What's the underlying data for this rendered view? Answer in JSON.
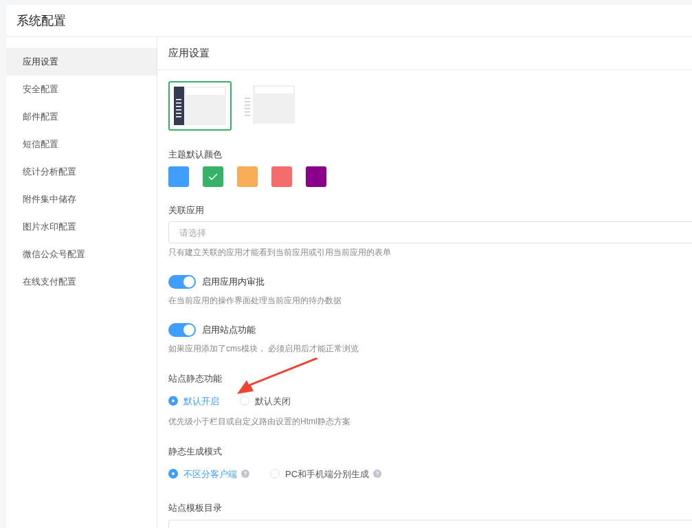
{
  "page_title": "系统配置",
  "sidebar": {
    "items": [
      {
        "label": "应用设置",
        "selected": true
      },
      {
        "label": "安全配置",
        "selected": false
      },
      {
        "label": "邮件配置",
        "selected": false
      },
      {
        "label": "短信配置",
        "selected": false
      },
      {
        "label": "统计分析配置",
        "selected": false
      },
      {
        "label": "附件集中储存",
        "selected": false
      },
      {
        "label": "图片水印配置",
        "selected": false
      },
      {
        "label": "微信公众号配置",
        "selected": false
      },
      {
        "label": "在线支付配置",
        "selected": false
      }
    ]
  },
  "content": {
    "title": "应用设置",
    "theme_styles": [
      {
        "kind": "dark",
        "selected": true
      },
      {
        "kind": "light",
        "selected": false
      }
    ],
    "theme_color": {
      "label": "主题默认颜色",
      "swatches": [
        {
          "color": "#409eff",
          "selected": false
        },
        {
          "color": "#36b368",
          "selected": true
        },
        {
          "color": "#f7ae56",
          "selected": false
        },
        {
          "color": "#f56c6c",
          "selected": false
        },
        {
          "color": "#8b008b",
          "selected": false
        }
      ]
    },
    "linked_app": {
      "label": "关联应用",
      "placeholder": "请选择",
      "help": "只有建立关联的应用才能看到当前应用或引用当前应用的表单"
    },
    "switches": [
      {
        "label": "启用应用内审批",
        "on": true,
        "help": "在当前应用的操作界面处理当前应用的待办数据"
      },
      {
        "label": "启用站点功能",
        "on": true,
        "help": "如果应用添加了cms模块， 必须启用后才能正常浏览"
      }
    ],
    "radio_groups": [
      {
        "label": "站点静态功能",
        "options": [
          {
            "label": "默认开启",
            "selected": true
          },
          {
            "label": "默认关闭",
            "selected": false
          }
        ],
        "help": "优先级小于栏目或自定义路由设置的Html静态方案"
      },
      {
        "label": "静态生成模式",
        "options": [
          {
            "label": "不区分客户端",
            "selected": true,
            "hint": true
          },
          {
            "label": "PC和手机端分别生成",
            "selected": false,
            "hint": true
          }
        ]
      }
    ],
    "template_dir": {
      "label": "站点模板目录"
    }
  }
}
